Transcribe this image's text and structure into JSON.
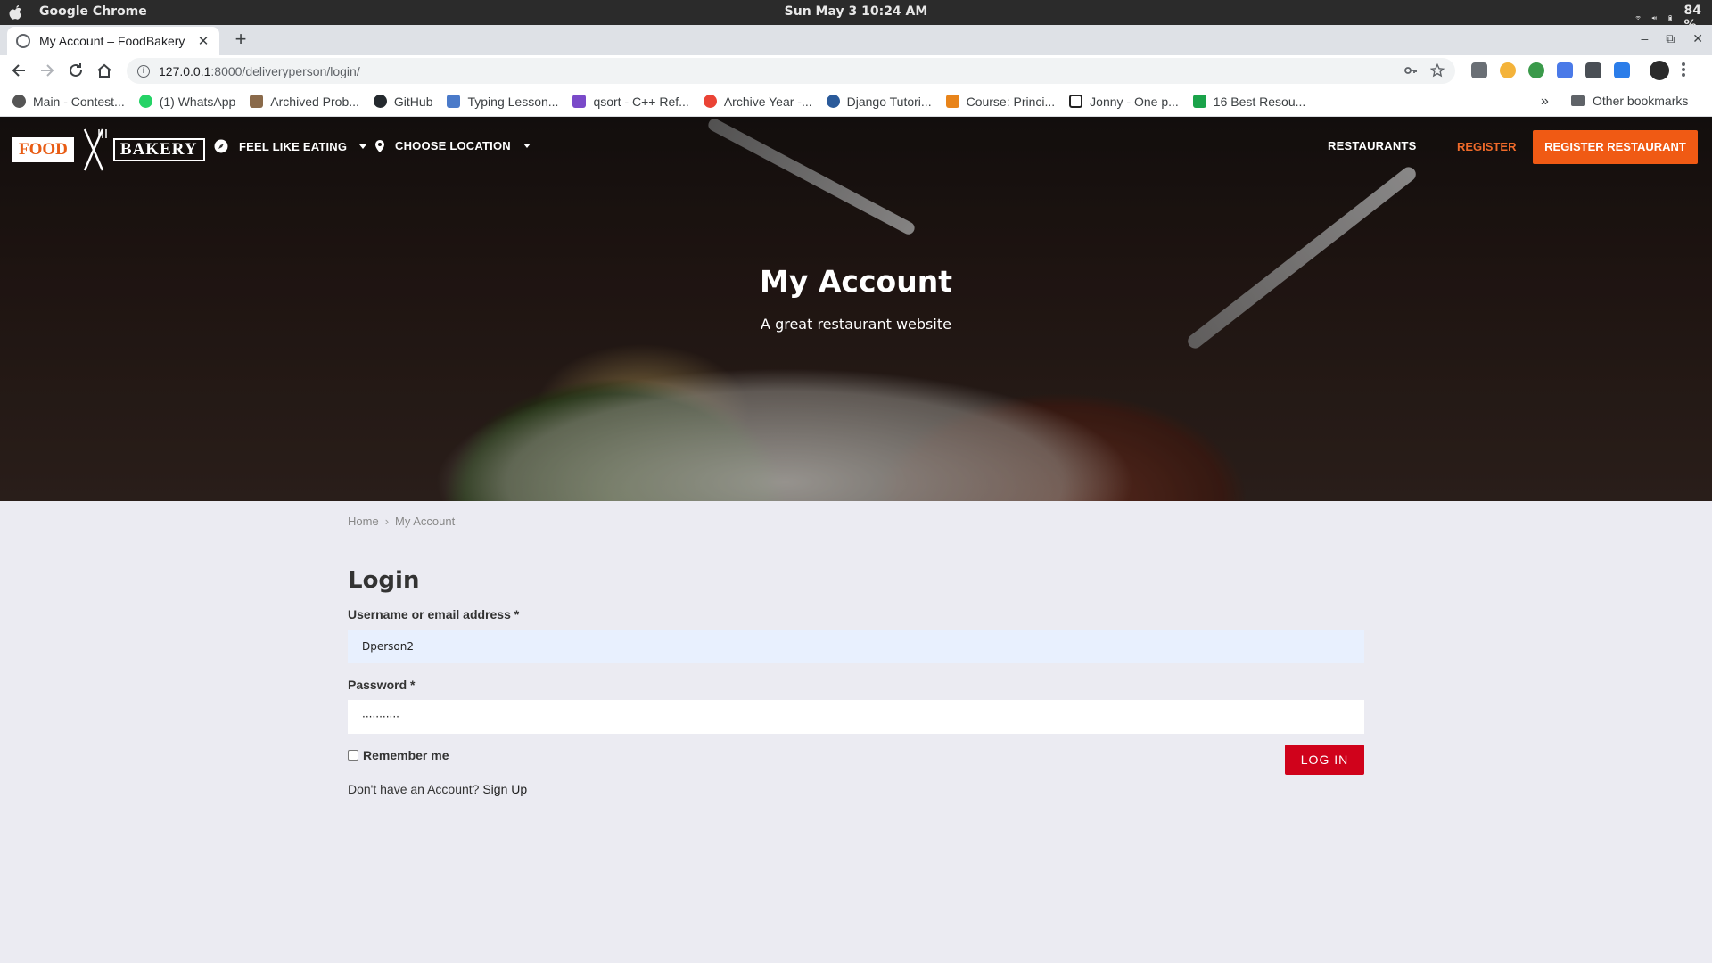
{
  "os": {
    "app_name": "Google Chrome",
    "clock": "Sun May 3  10:24 AM",
    "battery": "84 %"
  },
  "browser": {
    "tab_title": "My Account – FoodBakery",
    "tab_close": "✕",
    "new_tab": "+",
    "url_host": "127.0.0.1",
    "url_path": ":8000/deliveryperson/login/",
    "window_controls": [
      "–",
      "⧉",
      "✕"
    ],
    "bookmarks": [
      {
        "label": "Main - Contest...",
        "color": "#555555"
      },
      {
        "label": "(1) WhatsApp",
        "color": "#25d366"
      },
      {
        "label": "Archived Prob...",
        "color": "#8a6a4a"
      },
      {
        "label": "GitHub",
        "color": "#24292e"
      },
      {
        "label": "Typing Lesson...",
        "color": "#4a7ac9"
      },
      {
        "label": "qsort - C++ Ref...",
        "color": "#7a4ac9"
      },
      {
        "label": "Archive Year -...",
        "color": "#ea4335"
      },
      {
        "label": "Django Tutori...",
        "color": "#2a5a9a"
      },
      {
        "label": "Course: Princi...",
        "color": "#e8841a"
      },
      {
        "label": "Jonny - One p...",
        "color": "#222222"
      },
      {
        "label": "16 Best Resou...",
        "color": "#1aa34a"
      }
    ],
    "bookmarks_more": "»",
    "other_bookmarks": "Other bookmarks"
  },
  "site": {
    "logo_food": "FOOD",
    "logo_bakery": "BAKERY",
    "nav_feel_like_eating": "FEEL LIKE EATING",
    "nav_choose_location": "CHOOSE LOCATION",
    "nav_restaurants": "RESTAURANTS",
    "nav_register": "REGISTER",
    "register_restaurant": "REGISTER RESTAURANT",
    "hero_title": "My Account",
    "hero_subtitle": "A great restaurant website",
    "accent_color": "#f05a14",
    "login_button_color": "#d0021b"
  },
  "breadcrumb": {
    "home": "Home",
    "sep": "›",
    "current": "My Account"
  },
  "login": {
    "title": "Login",
    "username_label": "Username or email address *",
    "username_value": "Dperson2",
    "password_label": "Password *",
    "password_value": "···········",
    "remember_label": "Remember me",
    "remember_checked": false,
    "submit_label": "LOG IN",
    "no_account_text": "Don't have an Account?",
    "signup_link": "Sign Up"
  }
}
